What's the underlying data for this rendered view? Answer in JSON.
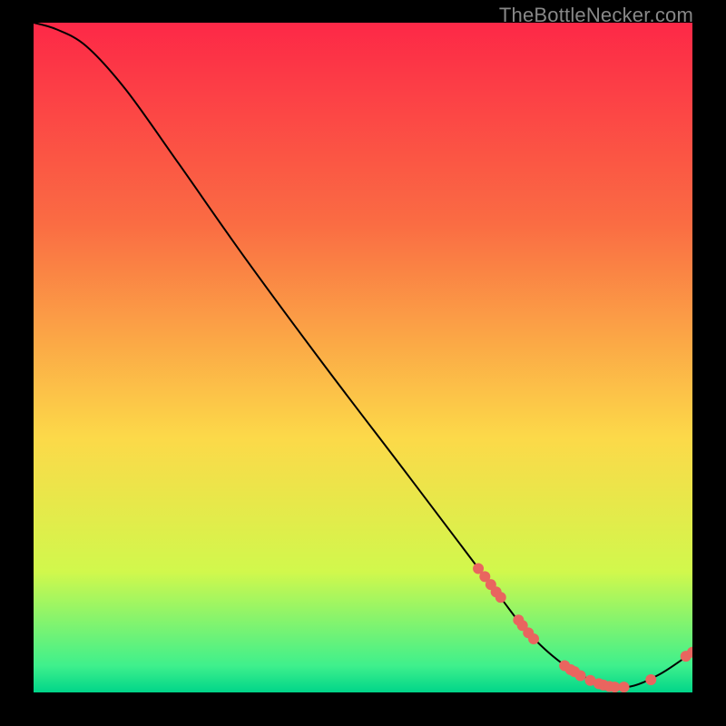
{
  "watermark": {
    "text": "TheBottleNecker.com"
  },
  "chart_data": {
    "type": "line",
    "title": "",
    "xlabel": "",
    "ylabel": "",
    "xlim": [
      0,
      100
    ],
    "ylim": [
      0,
      100
    ],
    "grid": false,
    "legend": false,
    "background_gradient": {
      "colors": [
        "#fd2847",
        "#fa6c43",
        "#fcd949",
        "#d1f84c",
        "#3ff08c",
        "#00d589"
      ],
      "positions": [
        0,
        0.3,
        0.62,
        0.82,
        0.96,
        1.0
      ]
    },
    "series": [
      {
        "name": "curve",
        "x": [
          0,
          3.5,
          8,
          14,
          22,
          32,
          44,
          56,
          66,
          71,
          75,
          80,
          85,
          90,
          95,
          100
        ],
        "y": [
          100,
          99,
          96.5,
          90,
          79,
          65,
          49,
          33.5,
          20.5,
          14,
          9,
          4.5,
          1.7,
          0.8,
          2.7,
          6
        ],
        "stroke": "#000000",
        "stroke_width": 2
      }
    ],
    "points": {
      "name": "selected-points",
      "color": "#e9655f",
      "radius": 6,
      "items": [
        {
          "x": 67.5,
          "y": 18.5
        },
        {
          "x": 68.5,
          "y": 17.3
        },
        {
          "x": 69.4,
          "y": 16.1
        },
        {
          "x": 70.2,
          "y": 15.0
        },
        {
          "x": 70.9,
          "y": 14.2
        },
        {
          "x": 73.6,
          "y": 10.8
        },
        {
          "x": 74.2,
          "y": 10.0
        },
        {
          "x": 75.1,
          "y": 8.9
        },
        {
          "x": 75.9,
          "y": 8.0
        },
        {
          "x": 80.6,
          "y": 4.0
        },
        {
          "x": 81.5,
          "y": 3.4
        },
        {
          "x": 82.1,
          "y": 3.1
        },
        {
          "x": 83.0,
          "y": 2.5
        },
        {
          "x": 84.5,
          "y": 1.8
        },
        {
          "x": 85.8,
          "y": 1.3
        },
        {
          "x": 86.5,
          "y": 1.1
        },
        {
          "x": 87.4,
          "y": 0.9
        },
        {
          "x": 88.2,
          "y": 0.8
        },
        {
          "x": 89.6,
          "y": 0.8
        },
        {
          "x": 93.7,
          "y": 1.9
        },
        {
          "x": 99.0,
          "y": 5.4
        },
        {
          "x": 100.0,
          "y": 6.0
        }
      ]
    }
  }
}
